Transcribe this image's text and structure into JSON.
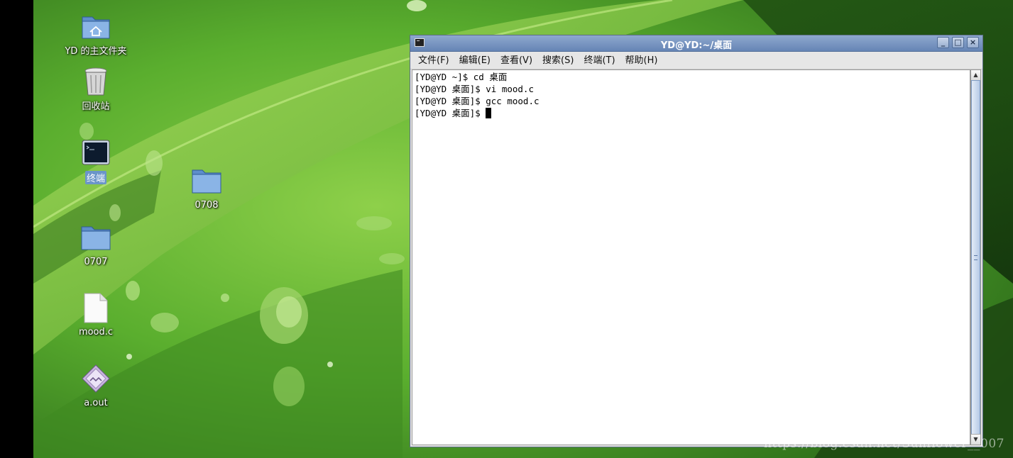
{
  "desktop": {
    "icons": [
      {
        "label": "YD 的主文件夹",
        "icon": "home-folder-icon"
      },
      {
        "label": "回收站",
        "icon": "trash-icon"
      },
      {
        "label": "终端",
        "icon": "terminal-icon",
        "selected": true
      },
      {
        "label": "0708",
        "icon": "folder-icon"
      },
      {
        "label": "0707",
        "icon": "folder-icon"
      },
      {
        "label": "mood.c",
        "icon": "text-file-icon"
      },
      {
        "label": "a.out",
        "icon": "executable-icon"
      }
    ]
  },
  "window": {
    "title": "YD@YD:~/桌面",
    "buttons": {
      "minimize": "_",
      "maximize": "□",
      "close": "×"
    },
    "menu": [
      "文件(F)",
      "编辑(E)",
      "查看(V)",
      "搜索(S)",
      "终端(T)",
      "帮助(H)"
    ],
    "terminal_lines": [
      "[YD@YD ~]$ cd 桌面",
      "[YD@YD 桌面]$ vi mood.c",
      "[YD@YD 桌面]$ gcc mood.c",
      "[YD@YD 桌面]$ "
    ]
  },
  "watermark": "https://blog.csdn.net/Sunflower__007",
  "colors": {
    "titlebar": "#6685b5",
    "selection": "#6b95c9",
    "wallpaper": "#4fa52c"
  }
}
